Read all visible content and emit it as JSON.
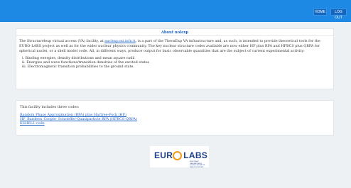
{
  "nav": {
    "home_label": "HOME",
    "logout_label": "LOG OUT"
  },
  "about": {
    "title": "About nolexp",
    "intro_before": "The Structurelexp virtual access (VA) facility, at ",
    "intro_link": "nuclexp.mi.infn.it",
    "intro_after": ", is a part of the TheoxExp VA infrastructure and, as such, is intended to provide theoretical tools for the EURO-LABS project as well as for the wider nuclear physics community. The key nuclear structure codes available are now either HF plus RPA and HFBCS plus QRPA for spherical nuclei, or a shell model code. All, in different ways, produce output for basic observable quantities that are the subject of current experimental activity:",
    "items": [
      "i. Binding energies, density distributions and mean square radii",
      "ii. Energies and wave functions/transition densities of the excited states",
      "iii. Electromagnetic transition probabilities to the ground state."
    ]
  },
  "facility": {
    "intro": "This facility includes three codes:",
    "codes": [
      "Random Phase Approximation (RPA) plus Hartree-Fock (HF)",
      "HF_Bardeen_Cooper_Schrieffer-Quasiparticle RPA (HFBCS-QRPA)",
      "KSHELL code"
    ]
  },
  "logo": {
    "text_left": "EUR",
    "text_right": "LABS",
    "subtitle": "EUROPEAN LABORATORIES FOR ACCELERATOR BASED SCIENCES",
    "colors": {
      "blue": "#1d3f8a",
      "orange": "#f29a1a"
    }
  },
  "colors": {
    "topbar": "#1e88e5",
    "link": "#1e63c4",
    "background": "#eef1f4"
  }
}
